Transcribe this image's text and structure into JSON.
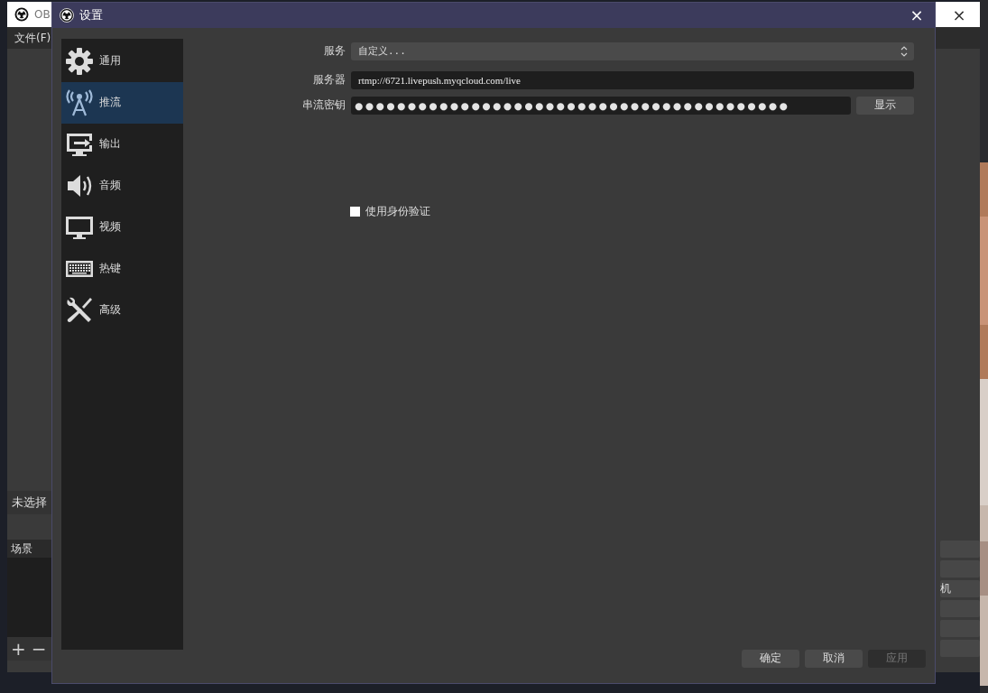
{
  "background_window": {
    "title": "OB",
    "close": "×",
    "menu": [
      "文件(F)"
    ],
    "source_label": "未选择",
    "scenes_title": "场景",
    "scene_buttons": [
      "+",
      "−"
    ],
    "side_button": "机"
  },
  "dialog": {
    "title": "设置",
    "close": "×"
  },
  "sidebar": {
    "items": [
      {
        "label": "通用",
        "selected": false
      },
      {
        "label": "推流",
        "selected": true
      },
      {
        "label": "输出",
        "selected": false
      },
      {
        "label": "音频",
        "selected": false
      },
      {
        "label": "视频",
        "selected": false
      },
      {
        "label": "热键",
        "selected": false
      },
      {
        "label": "高级",
        "selected": false
      }
    ]
  },
  "stream": {
    "service": {
      "label": "服务",
      "value": "自定义..."
    },
    "server": {
      "label": "服务器",
      "value": "rtmp://6721.livepush.myqcloud.com/live"
    },
    "key": {
      "label": "串流密钥",
      "value": "●●●●●●●●●●●●●●●●●●●●●●●●●●●●●●●●●●●●●●●●●",
      "button": "显示"
    },
    "auth": {
      "label": "使用身份验证",
      "checked": false
    }
  },
  "buttons": [
    {
      "label": "确定",
      "disabled": false
    },
    {
      "label": "取消",
      "disabled": false
    },
    {
      "label": "应用",
      "disabled": true
    }
  ]
}
